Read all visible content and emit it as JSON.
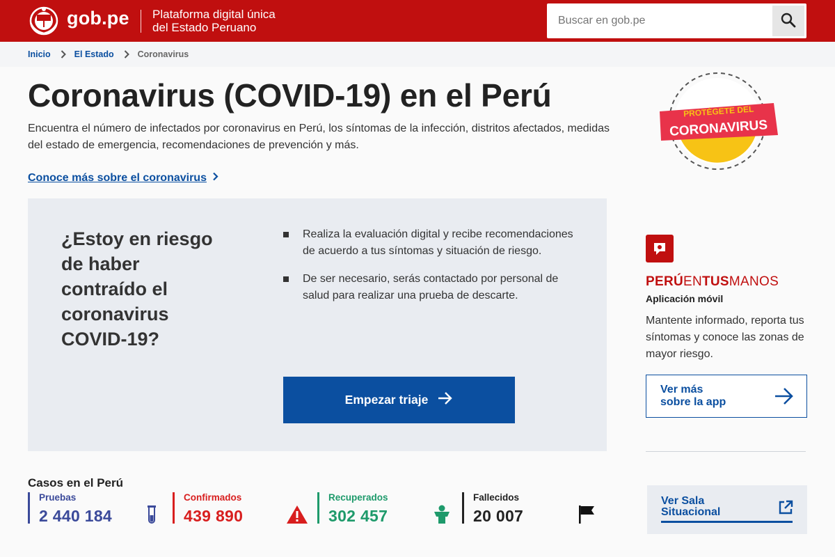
{
  "header": {
    "logo_text": "gob.pe",
    "tagline_line1": "Plataforma digital única",
    "tagline_line2": "del Estado Peruano",
    "search_placeholder": "Buscar en gob.pe",
    "brand_color": "#c00f0f"
  },
  "breadcrumb": {
    "items": [
      "Inicio",
      "El Estado"
    ],
    "current": "Coronavirus"
  },
  "main": {
    "title": "Coronavirus (COVID-19) en el Perú",
    "description": "Encuentra el número de infectados por coronavirus en Perú, los síntomas de la infección, distritos afectados, medidas del estado de emergencia, recomendaciones de prevención y más.",
    "more_link": "Conoce más sobre el coronavirus"
  },
  "badge": {
    "top_text": "PROTÉGETE DEL",
    "main_text": "CORONAVIRUS"
  },
  "triage": {
    "question": "¿Estoy en riesgo de haber contraído el coronavirus COVID-19?",
    "bullets": [
      "Realiza la evaluación digital y recibe recomendaciones de acuerdo a tus síntomas y situación de riesgo.",
      "De ser necesario, serás contactado por personal de salud para realizar una prueba de descarte."
    ],
    "button_label": "Empezar triaje",
    "button_color": "#0b4fa0"
  },
  "app": {
    "brand_peru": "PERÚ",
    "brand_en": "EN",
    "brand_tus": "TUS",
    "brand_manos": "MANOS",
    "subtitle": "Aplicación móvil",
    "description": "Mantente informado, reporta tus síntomas y conoce las zonas de mayor riesgo.",
    "button_line1": "Ver más",
    "button_line2": "sobre la app"
  },
  "sala": {
    "line1": "Ver Sala",
    "line2": "Situacional"
  },
  "cases": {
    "title": "Casos en el Perú",
    "stats": [
      {
        "label": "Pruebas",
        "value": "2 440 184",
        "color": "#3b4a9a",
        "icon": "test-tube-icon"
      },
      {
        "label": "Confirmados",
        "value": "439 890",
        "color": "#d81e1e",
        "icon": "warning-icon"
      },
      {
        "label": "Recuperados",
        "value": "302 457",
        "color": "#1e9a6b",
        "icon": "person-icon"
      },
      {
        "label": "Fallecidos",
        "value": "20 007",
        "color": "#222222",
        "icon": "flag-icon"
      }
    ]
  }
}
